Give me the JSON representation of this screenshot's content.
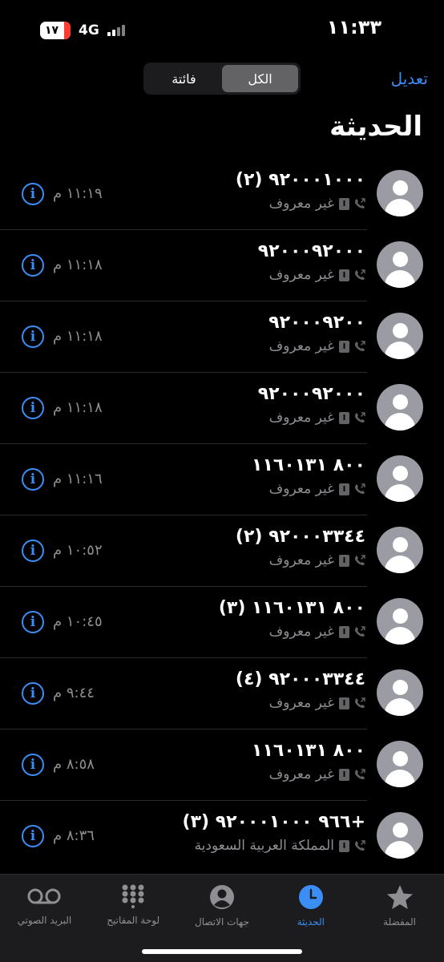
{
  "status_bar": {
    "time": "١١:٣٣",
    "battery": "١٧",
    "network": "4G"
  },
  "header": {
    "edit_label": "تعديل",
    "segments": [
      {
        "label": "الكل",
        "active": true
      },
      {
        "label": "فائتة",
        "active": false
      }
    ],
    "title": "الحديثة"
  },
  "calls": [
    {
      "number": "٩٢٠٠٠١٠٠٠ (٢)",
      "label": "غير معروف",
      "time": "١١:١٩ م"
    },
    {
      "number": "٩٢٠٠٠٩٢٠٠٠",
      "label": "غير معروف",
      "time": "١١:١٨ م"
    },
    {
      "number": "٩٢٠٠٠٩٢٠٠",
      "label": "غير معروف",
      "time": "١١:١٨ م"
    },
    {
      "number": "٩٢٠٠٠٩٢٠٠٠",
      "label": "غير معروف",
      "time": "١١:١٨ م"
    },
    {
      "number": "٨٠٠ ١١٦٠١٣١",
      "label": "غير معروف",
      "time": "١١:١٦ م"
    },
    {
      "number": "٩٢٠٠٠٣٣٤٤ (٢)",
      "label": "غير معروف",
      "time": "١٠:٥٢ م"
    },
    {
      "number": "٨٠٠ ١١٦٠١٣١ (٣)",
      "label": "غير معروف",
      "time": "١٠:٤٥ م"
    },
    {
      "number": "٩٢٠٠٠٣٣٤٤ (٤)",
      "label": "غير معروف",
      "time": "٩:٤٤ م"
    },
    {
      "number": "٨٠٠ ١١٦٠١٣١",
      "label": "غير معروف",
      "time": "٨:٥٨ م"
    },
    {
      "number": "+٩٦٦ ٩٢٠٠٠١٠٠٠ (٣)",
      "label": "المملكة العربية السعودية",
      "time": "٨:٣٦ م"
    }
  ],
  "tab_bar": {
    "tabs": [
      {
        "label": "البريد الصوتي",
        "icon": "voicemail-icon",
        "active": false
      },
      {
        "label": "لوحة المفاتيح",
        "icon": "keypad-icon",
        "active": false
      },
      {
        "label": "جهات الاتصال",
        "icon": "contacts-icon",
        "active": false
      },
      {
        "label": "الحديثة",
        "icon": "recents-clock-icon",
        "active": true
      },
      {
        "label": "المفضلة",
        "icon": "favorites-star-icon",
        "active": false
      }
    ]
  },
  "colors": {
    "accent": "#3a8ef6",
    "background": "#000000",
    "secondary_text": "#8e8e93",
    "avatar": "#9a9ba3"
  }
}
